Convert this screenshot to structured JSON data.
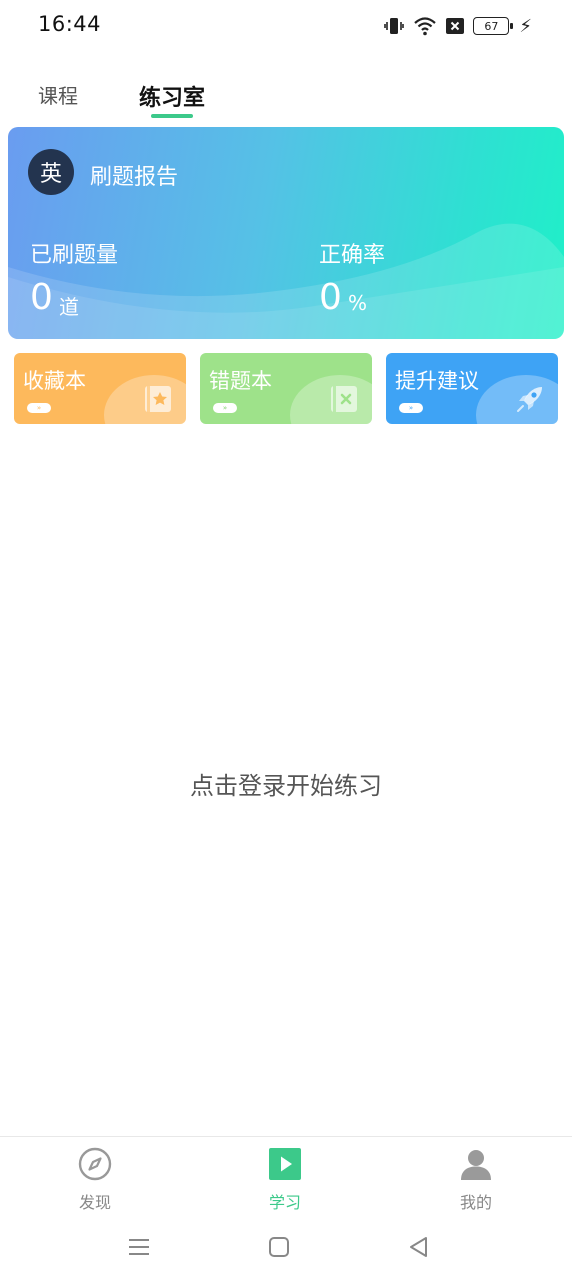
{
  "status_bar": {
    "time": "16:44",
    "battery": "67"
  },
  "top_tabs": [
    {
      "label": "课程"
    },
    {
      "label": "练习室",
      "active": true
    }
  ],
  "report": {
    "subject": "英",
    "title": "刷题报告",
    "stats": [
      {
        "label": "已刷题量",
        "value": "0",
        "unit": "道"
      },
      {
        "label": "正确率",
        "value": "0",
        "unit": "%"
      }
    ]
  },
  "quick_cards": [
    {
      "label": "收藏本",
      "color": "#fdb95c",
      "icon": "bookmark-star-icon"
    },
    {
      "label": "错题本",
      "color": "#9ee28a",
      "icon": "notebook-x-icon"
    },
    {
      "label": "提升建议",
      "color": "#3ea3f5",
      "icon": "rocket-icon"
    }
  ],
  "pill_glyph": "»",
  "login_hint": "点击登录开始练习",
  "bottom_nav": [
    {
      "label": "发现",
      "icon": "compass-icon"
    },
    {
      "label": "学习",
      "icon": "play-square-icon",
      "active": true
    },
    {
      "label": "我的",
      "icon": "user-icon"
    }
  ],
  "colors": {
    "accent": "#3cc98a",
    "badge": "#23344f"
  }
}
